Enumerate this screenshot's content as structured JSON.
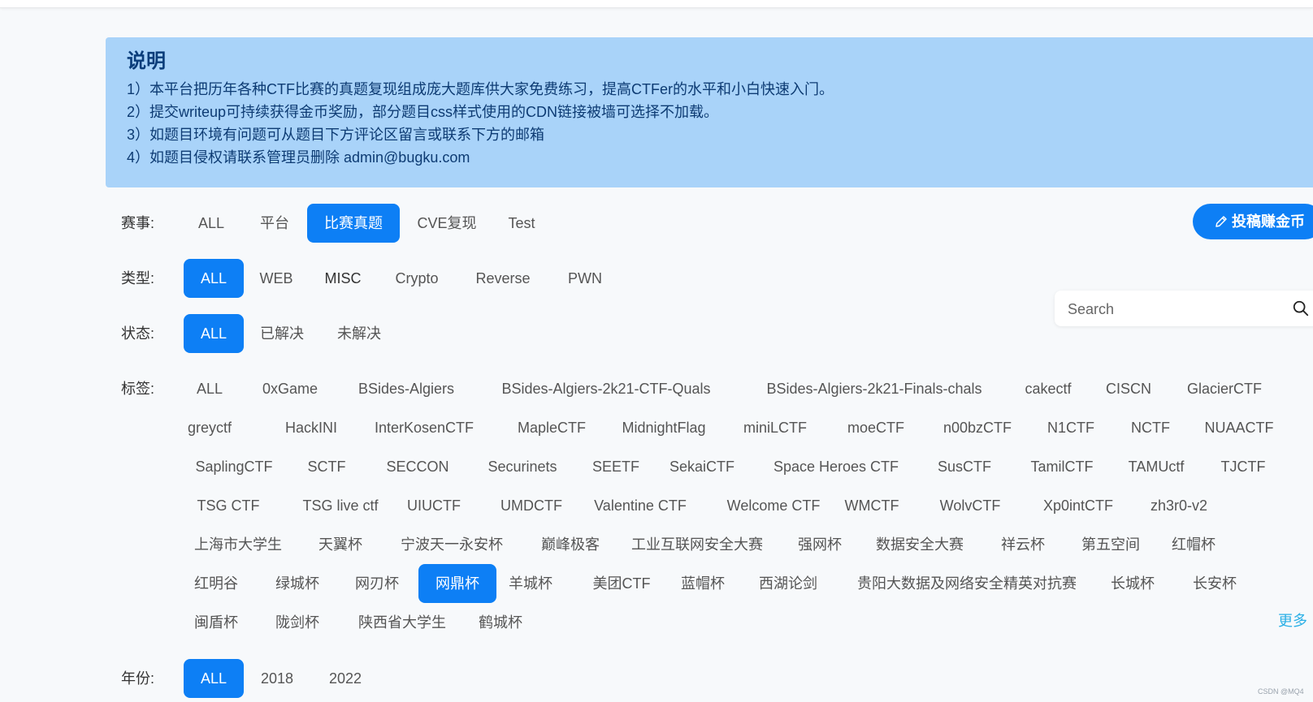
{
  "notice": {
    "title": "说明",
    "lines": [
      "1）本平台把历年各种CTF比赛的真题复现组成庞大题库供大家免费练习，提高CTFer的水平和小白快速入门。",
      "2）提交writeup可持续获得金币奖励，部分题目css样式使用的CDN链接被墙可选择不加载。",
      "3）如题目环境有问题可从题目下方评论区留言或联系下方的邮箱",
      "4）如题目侵权请联系管理员删除 admin@bugku.com"
    ]
  },
  "filters": {
    "event": {
      "label": "赛事:",
      "options": [
        "ALL",
        "平台",
        "比赛真题",
        "CVE复现",
        "Test"
      ],
      "selected": "比赛真题"
    },
    "type": {
      "label": "类型:",
      "options": [
        "ALL",
        "WEB",
        "MISC",
        "Crypto",
        "Reverse",
        "PWN"
      ],
      "selected": "ALL"
    },
    "status": {
      "label": "状态:",
      "options": [
        "ALL",
        "已解决",
        "未解决"
      ],
      "selected": "ALL"
    },
    "tags": {
      "label": "标签:",
      "options": [
        "ALL",
        "0xGame",
        "BSides-Algiers",
        "BSides-Algiers-2k21-CTF-Quals",
        "BSides-Algiers-2k21-Finals-chals",
        "cakectf",
        "CISCN",
        "GlacierCTF",
        "greyctf",
        "HackINI",
        "InterKosenCTF",
        "MapleCTF",
        "MidnightFlag",
        "miniLCTF",
        "moeCTF",
        "n00bzCTF",
        "N1CTF",
        "NCTF",
        "NUAACTF",
        "SaplingCTF",
        "SCTF",
        "SECCON",
        "Securinets",
        "SEETF",
        "SekaiCTF",
        "Space Heroes CTF",
        "SusCTF",
        "TamilCTF",
        "TAMUctf",
        "TJCTF",
        "TSG CTF",
        "TSG live ctf",
        "UIUCTF",
        "UMDCTF",
        "Valentine CTF",
        "Welcome CTF",
        "WMCTF",
        "WolvCTF",
        "Xp0intCTF",
        "zh3r0-v2",
        "上海市大学生",
        "天翼杯",
        "宁波天一永安杯",
        "巅峰极客",
        "工业互联网安全大赛",
        "强网杯",
        "数据安全大赛",
        "祥云杯",
        "第五空间",
        "红帽杯",
        "红明谷",
        "绿城杯",
        "网刃杯",
        "网鼎杯",
        "羊城杯",
        "美团CTF",
        "蓝帽杯",
        "西湖论剑",
        "贵阳大数据及网络安全精英对抗赛",
        "长城杯",
        "长安杯",
        "闽盾杯",
        "陇剑杯",
        "陕西省大学生",
        "鹤城杯"
      ],
      "selected": "网鼎杯",
      "more_label": "更多"
    },
    "year": {
      "label": "年份:",
      "options": [
        "ALL",
        "2018",
        "2022"
      ],
      "selected": "ALL"
    }
  },
  "submit_button": {
    "label": "投稿赚金币",
    "icon": "pencil-icon"
  },
  "search": {
    "placeholder": "Search",
    "value": "",
    "icon": "search-icon"
  },
  "watermark": "CSDN @MQ4",
  "colors": {
    "accent": "#0d7ff5",
    "notice_bg": "#a9d3f9",
    "notice_text": "#0d3b73",
    "more_link": "#2bb0e6"
  }
}
